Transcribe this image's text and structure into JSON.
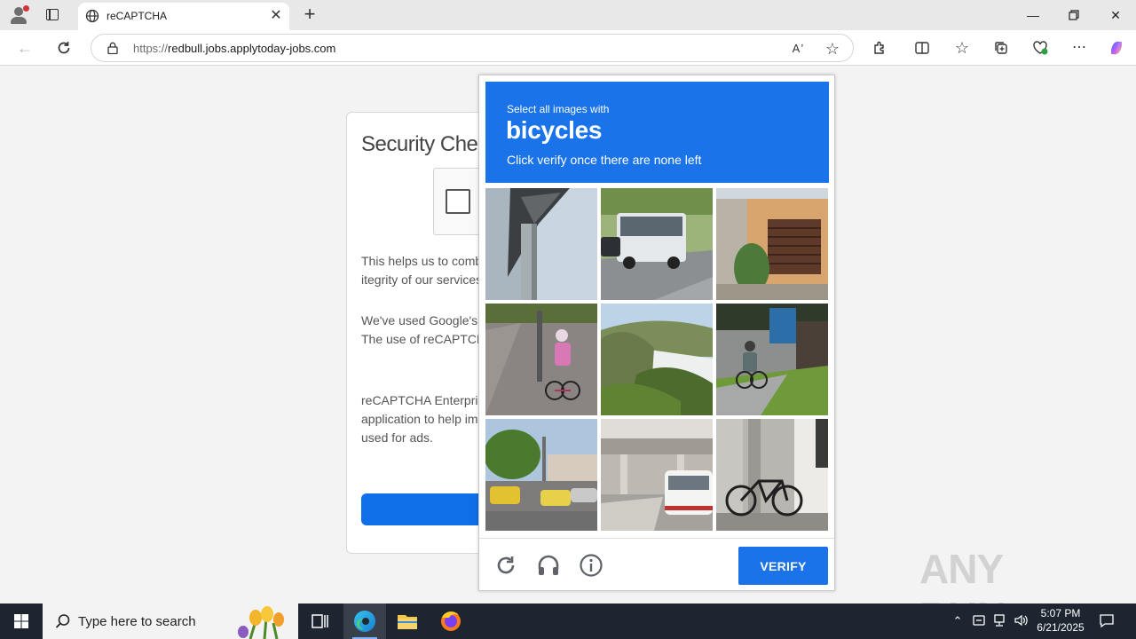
{
  "browser": {
    "tab_title": "reCAPTCHA",
    "url_scheme": "https://",
    "url_host": "redbull.jobs.applytoday-jobs.com",
    "new_tab_symbol": "+",
    "tab_close_symbol": "✕"
  },
  "page": {
    "heading": "Security Check",
    "paragraph1": "This helps us to combat harmful conduct, detect abuse and maintain the itegrity of our services.",
    "paragraph2": "We've used Google's reCAPTCHA Enterprise product to provide this check. The use of reCAPTCHA Enterprise is subject to Google's Terms of Use.",
    "paragraph3": "reCAPTCHA Enterprise may collect information about hardware, device and application to help improve reCAPTCHA Enterprise. This information is not used for ads."
  },
  "captcha": {
    "line1": "Select all images with",
    "target": "bicycles",
    "line3": "Click verify once there are none left",
    "verify_label": "VERIFY",
    "tiles": [
      "tile-pole-overpass",
      "tile-bus-road",
      "tile-building-window",
      "tile-cyclist-pink",
      "tile-hillside-trees",
      "tile-cyclist-grass",
      "tile-street-cars",
      "tile-underpass-bus",
      "tile-parked-bicycle"
    ]
  },
  "taskbar": {
    "search_placeholder": "Type here to search",
    "time": "5:07 PM",
    "date": "6/21/2025"
  },
  "watermark": {
    "text": "ANY RUN"
  },
  "colors": {
    "accent": "#1a73e8",
    "taskbar": "#1c2530"
  }
}
